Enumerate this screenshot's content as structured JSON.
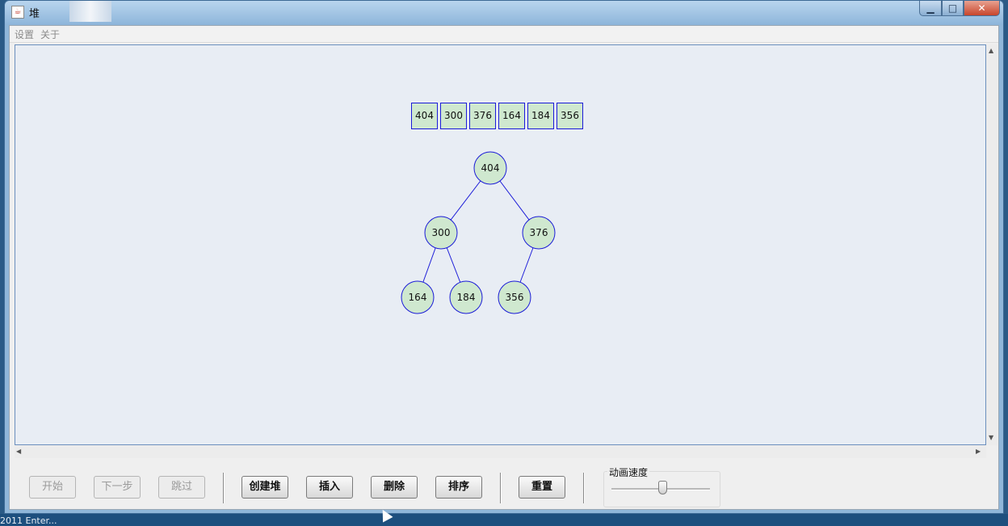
{
  "window": {
    "title": "堆",
    "app_icon": "java-icon",
    "controls": {
      "minimize": "▁",
      "maximize": "□",
      "close": "✕"
    }
  },
  "menu": {
    "items": [
      "设置",
      "关于"
    ]
  },
  "heap": {
    "array": [
      "404",
      "300",
      "376",
      "164",
      "184",
      "356"
    ],
    "tree_nodes": [
      "404",
      "300",
      "376",
      "164",
      "184",
      "356"
    ]
  },
  "toolbar": {
    "start_label": "开始",
    "next_step_label": "下一步",
    "skip_label": "跳过",
    "create_heap_label": "创建堆",
    "insert_label": "插入",
    "delete_label": "删除",
    "sort_label": "排序",
    "reset_label": "重置",
    "speed_label": "动画速度",
    "speed_level": 0.5
  },
  "taskbar": {
    "text": "2011 Enter..."
  },
  "colors": {
    "node_fill": "#cfe8cf",
    "node_border": "#1b1bd8",
    "canvas_bg": "#e8edf4"
  }
}
